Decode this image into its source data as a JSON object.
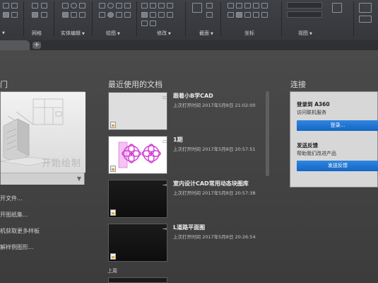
{
  "ribbon": {
    "panels": [
      {
        "label": "网格"
      },
      {
        "label": "实体编辑"
      },
      {
        "label": "绘图"
      },
      {
        "label": "修改"
      },
      {
        "label": "截面"
      },
      {
        "label": "坐标"
      },
      {
        "label": "视图"
      }
    ]
  },
  "tabs": {
    "new_tab": "+"
  },
  "start": {
    "title": "门",
    "caption": "开始绘制",
    "links": [
      "开文件...",
      "开图纸集...",
      "机获取更多样板",
      "解样例图形..."
    ]
  },
  "recent": {
    "title": "最近使用的文档",
    "items": [
      {
        "name": "跟着小B学CAD",
        "time": "上次打开时间 2017年5月8日 21:02:00",
        "thumb": "light"
      },
      {
        "name": "1期",
        "time": "上次打开时间 2017年5月8日 20:57:51",
        "thumb": "white"
      },
      {
        "name": "室内设计CAD常用动态块图库",
        "time": "上次打开时间 2017年5月8日 20:57:38",
        "thumb": "dark"
      },
      {
        "name": "L道路平面图",
        "time": "上次打开时间 2017年5月8日 20:26:54",
        "thumb": "dark"
      }
    ],
    "group_label": "上周"
  },
  "connect": {
    "title": "连接",
    "login_heading": "登录到 A360",
    "login_sub": "访问联机服务",
    "login_button": "登录...",
    "feedback_heading": "发送反馈",
    "feedback_sub": "帮助我们改进产品",
    "feedback_button": "发送反馈"
  },
  "colors": {
    "accent": "#1f74d4",
    "dark_bg": "#454545",
    "card_bg": "#d7d7d7"
  }
}
